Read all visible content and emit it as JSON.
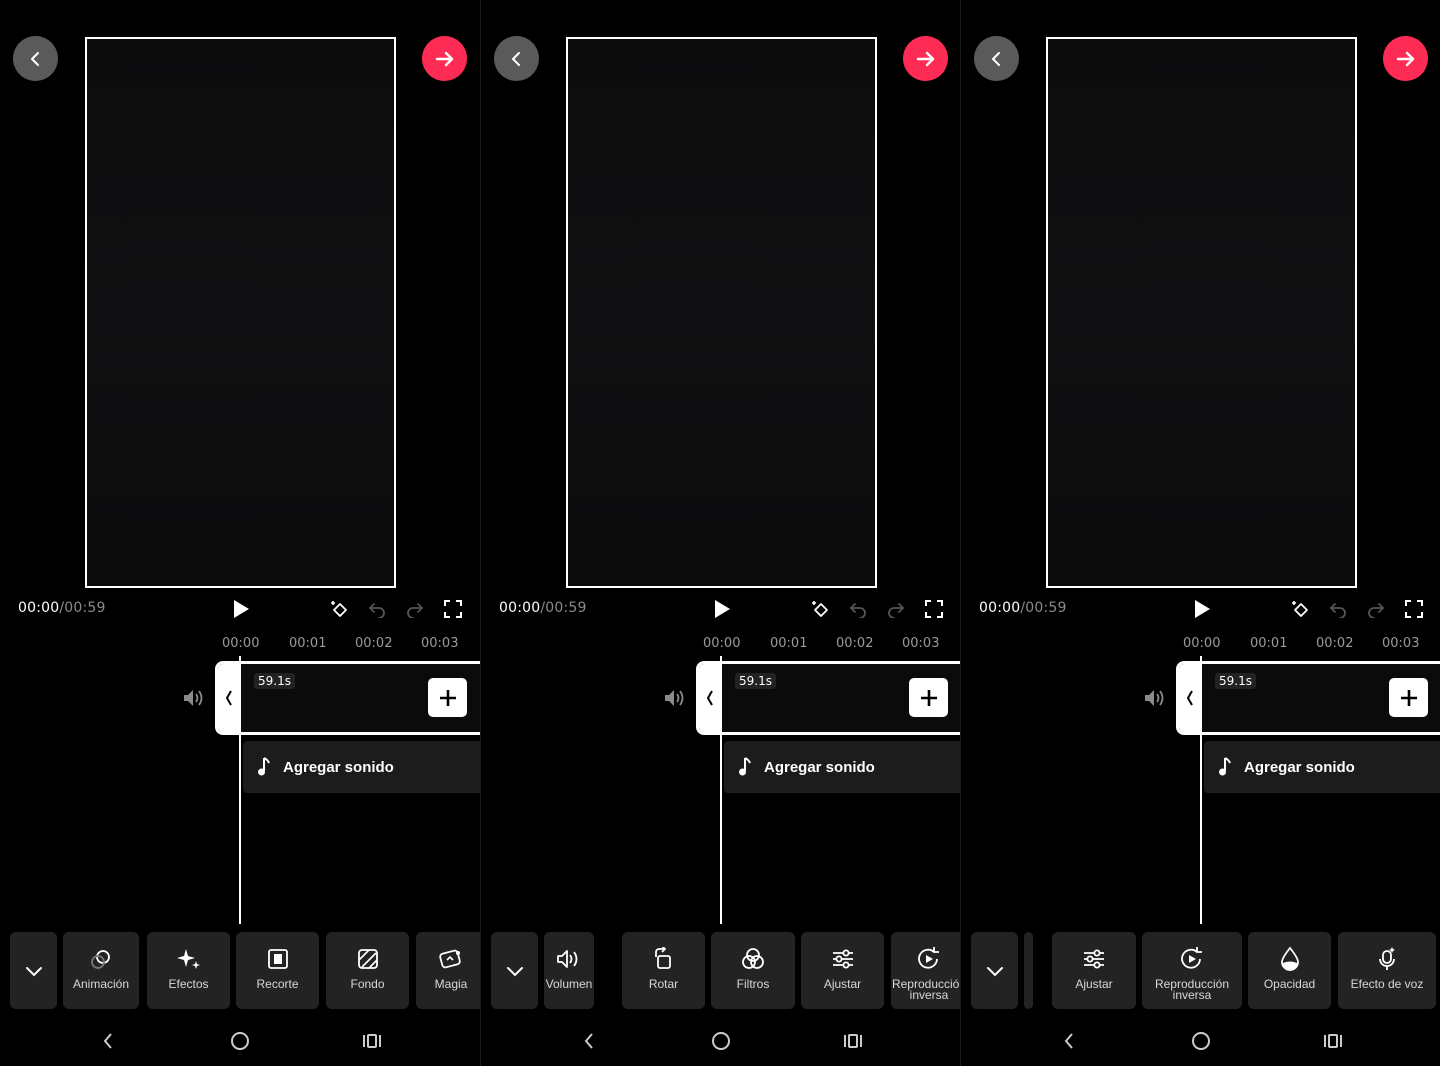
{
  "screens": [
    {
      "time_current": "00:00",
      "time_separator": "/",
      "time_total": "00:59",
      "ruler": [
        "00:00",
        "00:01",
        "00:02",
        "00:03"
      ],
      "clip_duration": "59.1s",
      "add_sound_label": "Agregar sonido",
      "tools": [
        {
          "label": "Animación",
          "icon": "animation-icon"
        },
        {
          "label": "Efectos",
          "icon": "sparkle-icon"
        },
        {
          "label": "Recorte",
          "icon": "crop-icon"
        },
        {
          "label": "Fondo",
          "icon": "background-icon"
        },
        {
          "label": "Magia",
          "icon": "magic-icon"
        }
      ]
    },
    {
      "time_current": "00:00",
      "time_separator": "/",
      "time_total": "00:59",
      "ruler": [
        "00:00",
        "00:01",
        "00:02",
        "00:03"
      ],
      "clip_duration": "59.1s",
      "add_sound_label": "Agregar sonido",
      "tools": [
        {
          "label": "Volumen",
          "icon": "volume-icon"
        },
        {
          "label": "Rotar",
          "icon": "rotate-icon"
        },
        {
          "label": "Filtros",
          "icon": "filters-icon"
        },
        {
          "label": "Ajustar",
          "icon": "adjust-icon"
        },
        {
          "label": "Reproducción inversa",
          "icon": "reverse-icon"
        }
      ]
    },
    {
      "time_current": "00:00",
      "time_separator": "/",
      "time_total": "00:59",
      "ruler": [
        "00:00",
        "00:01",
        "00:02",
        "00:03"
      ],
      "clip_duration": "59.1s",
      "add_sound_label": "Agregar sonido",
      "tools": [
        {
          "label": "Ajustar",
          "icon": "adjust-icon"
        },
        {
          "label": "Reproducción inversa",
          "icon": "reverse-icon"
        },
        {
          "label": "Opacidad",
          "icon": "opacity-icon"
        },
        {
          "label": "Efecto de voz",
          "icon": "voice-effect-icon"
        }
      ]
    }
  ],
  "colors": {
    "accent": "#fe2c55",
    "back_button": "#5a5a5a",
    "tool_button_bg": "#232323",
    "sound_track_bg": "#1c1c1c"
  }
}
